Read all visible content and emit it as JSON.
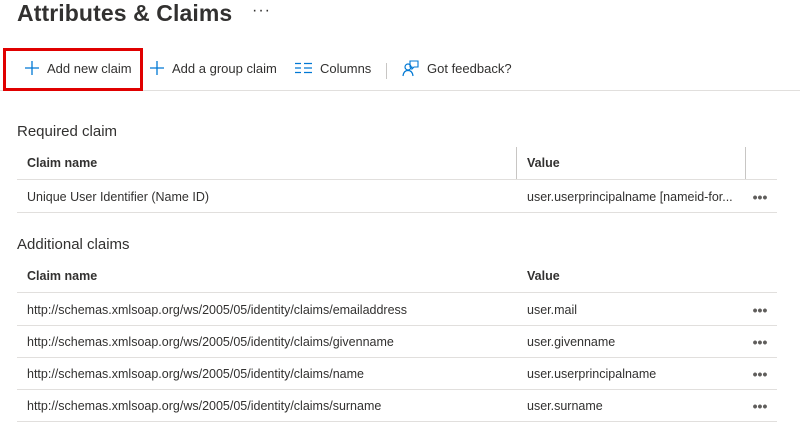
{
  "page": {
    "title": "Attributes & Claims",
    "more_label": "···"
  },
  "toolbar": {
    "add_new_claim": "Add new claim",
    "add_group_claim": "Add a group claim",
    "columns": "Columns",
    "feedback": "Got feedback?"
  },
  "required": {
    "title": "Required claim",
    "columns": [
      "Claim name",
      "Value"
    ],
    "rows": [
      {
        "name": "Unique User Identifier (Name ID)",
        "value": "user.userprincipalname [nameid-for...",
        "more": "•••"
      }
    ]
  },
  "additional": {
    "title": "Additional claims",
    "columns": [
      "Claim name",
      "Value"
    ],
    "rows": [
      {
        "name": "http://schemas.xmlsoap.org/ws/2005/05/identity/claims/emailaddress",
        "value": "user.mail",
        "more": "•••"
      },
      {
        "name": "http://schemas.xmlsoap.org/ws/2005/05/identity/claims/givenname",
        "value": "user.givenname",
        "more": "•••"
      },
      {
        "name": "http://schemas.xmlsoap.org/ws/2005/05/identity/claims/name",
        "value": "user.userprincipalname",
        "more": "•••"
      },
      {
        "name": "http://schemas.xmlsoap.org/ws/2005/05/identity/claims/surname",
        "value": "user.surname",
        "more": "•••"
      }
    ]
  },
  "colors": {
    "accent": "#0078d4",
    "highlight_border": "#e00000",
    "text": "#323130"
  }
}
